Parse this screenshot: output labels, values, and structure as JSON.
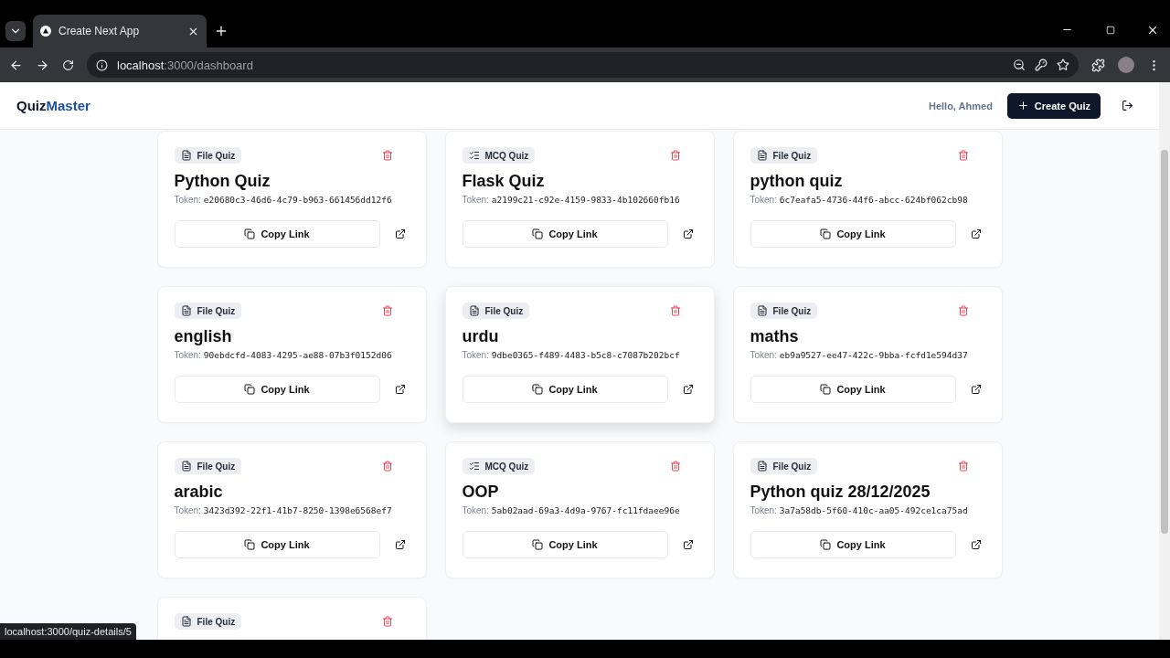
{
  "browser": {
    "tab": {
      "title": "Create Next App"
    },
    "url": {
      "host": "localhost",
      "rest": ":3000/dashboard"
    }
  },
  "header": {
    "brand": {
      "first": "Quiz",
      "second": "Master"
    },
    "greeting": "Hello, Ahmed",
    "create_button": "Create Quiz"
  },
  "cards": [
    {
      "kind": "file",
      "badge": "File Quiz",
      "title": "Python Quiz",
      "token_label": "Token:",
      "token": "e20680c3-46d6-4c79-b963-661456dd12f6",
      "copy": "Copy Link",
      "hovered": false
    },
    {
      "kind": "mcq",
      "badge": "MCQ Quiz",
      "title": "Flask Quiz",
      "token_label": "Token:",
      "token": "a2199c21-c92e-4159-9833-4b102660fb16",
      "copy": "Copy Link",
      "hovered": false
    },
    {
      "kind": "file",
      "badge": "File Quiz",
      "title": "python quiz",
      "token_label": "Token:",
      "token": "6c7eafa5-4736-44f6-abcc-624bf062cb98",
      "copy": "Copy Link",
      "hovered": false
    },
    {
      "kind": "file",
      "badge": "File Quiz",
      "title": "english",
      "token_label": "Token:",
      "token": "90ebdcfd-4083-4295-ae88-07b3f0152d06",
      "copy": "Copy Link",
      "hovered": false
    },
    {
      "kind": "file",
      "badge": "File Quiz",
      "title": "urdu",
      "token_label": "Token:",
      "token": "9dbe0365-f489-4483-b5c8-c7087b202bcf",
      "copy": "Copy Link",
      "hovered": true
    },
    {
      "kind": "file",
      "badge": "File Quiz",
      "title": "maths",
      "token_label": "Token:",
      "token": "eb9a9527-ee47-422c-9bba-fcfd1e594d37",
      "copy": "Copy Link",
      "hovered": false
    },
    {
      "kind": "file",
      "badge": "File Quiz",
      "title": "arabic",
      "token_label": "Token:",
      "token": "3423d392-22f1-41b7-8250-1398e6568ef7",
      "copy": "Copy Link",
      "hovered": false
    },
    {
      "kind": "mcq",
      "badge": "MCQ Quiz",
      "title": "OOP",
      "token_label": "Token:",
      "token": "5ab02aad-69a3-4d9a-9767-fc11fdaee96e",
      "copy": "Copy Link",
      "hovered": false
    },
    {
      "kind": "file",
      "badge": "File Quiz",
      "title": "Python quiz 28/12/2025",
      "token_label": "Token:",
      "token": "3a7a58db-5f60-410c-aa05-492ce1ca75ad",
      "copy": "Copy Link",
      "hovered": false
    },
    {
      "kind": "file",
      "badge": "File Quiz",
      "hovered": false
    }
  ],
  "status_link": "localhost:3000/quiz-details/5"
}
